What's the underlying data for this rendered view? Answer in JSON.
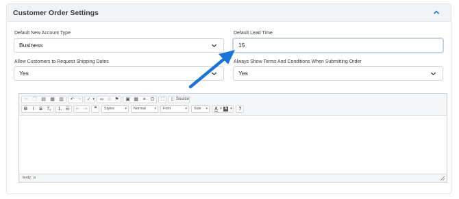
{
  "panel": {
    "title": "Customer Order Settings",
    "collapse_icon": "chevron-up-icon"
  },
  "fields": {
    "account_type": {
      "label": "Default New Account Type",
      "value": "Business"
    },
    "lead_time": {
      "label": "Default Lead Time",
      "value": "15"
    },
    "shipping_dates": {
      "label": "Allow Customers to Request Shipping Dates",
      "value": "Yes"
    },
    "terms": {
      "label": "Always Show Terms And Conditions When Submitting Order",
      "value": "Yes"
    }
  },
  "editor": {
    "source_label": "Source",
    "styles_label": "Styles",
    "format_label": "Normal",
    "font_label": "Font",
    "size_label": "Size",
    "help_label": "?",
    "path": [
      "body",
      "p"
    ]
  },
  "colors": {
    "arrow": "#1a73d9",
    "panel_header": "#f1f3f5"
  }
}
